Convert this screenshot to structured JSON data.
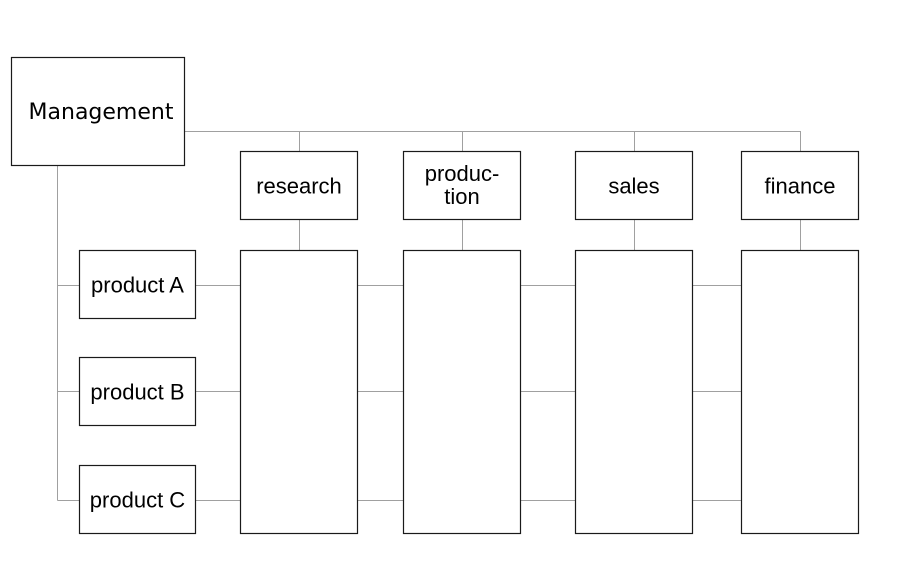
{
  "diagram": {
    "root": {
      "label": "Management"
    },
    "departments": [
      {
        "id": "research",
        "label_lines": [
          "research"
        ]
      },
      {
        "id": "production",
        "label_lines": [
          "produc-",
          "tion"
        ]
      },
      {
        "id": "sales",
        "label_lines": [
          "sales"
        ]
      },
      {
        "id": "finance",
        "label_lines": [
          "finance"
        ]
      }
    ],
    "products": [
      {
        "id": "product-a",
        "label": "product A"
      },
      {
        "id": "product-b",
        "label": "product B"
      },
      {
        "id": "product-c",
        "label": "product C"
      }
    ],
    "colors": {
      "box_stroke": "#1a1a1a",
      "connector": "#a0a0a0",
      "background": "#ffffff"
    }
  }
}
